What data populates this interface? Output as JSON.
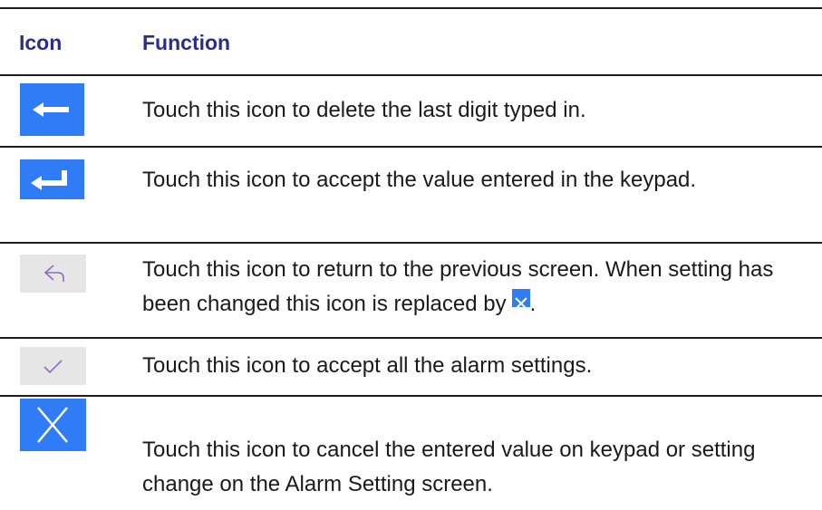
{
  "header": {
    "icon_col": "Icon",
    "function_col": "Function"
  },
  "rows": [
    {
      "icon": "backspace-icon",
      "text": "Touch this icon to delete the last digit typed in."
    },
    {
      "icon": "enter-icon",
      "text": "Touch this icon to accept the value entered in the keypad."
    },
    {
      "icon": "back-icon",
      "text_a": "Touch this icon to return to the previous screen. When setting has been changed this icon is replaced by",
      "text_b": "."
    },
    {
      "icon": "checkmark-icon",
      "text": "Touch this icon to accept all the alarm settings."
    },
    {
      "icon": "close-icon",
      "text": "Touch this icon to cancel the entered value on keypad or setting change on the Alarm Setting screen."
    }
  ],
  "colors": {
    "header": "#2b2c8c",
    "blue_icon": "#2f7cf6",
    "grey_icon": "#e6e6e6",
    "rule": "#1e1e1e"
  }
}
